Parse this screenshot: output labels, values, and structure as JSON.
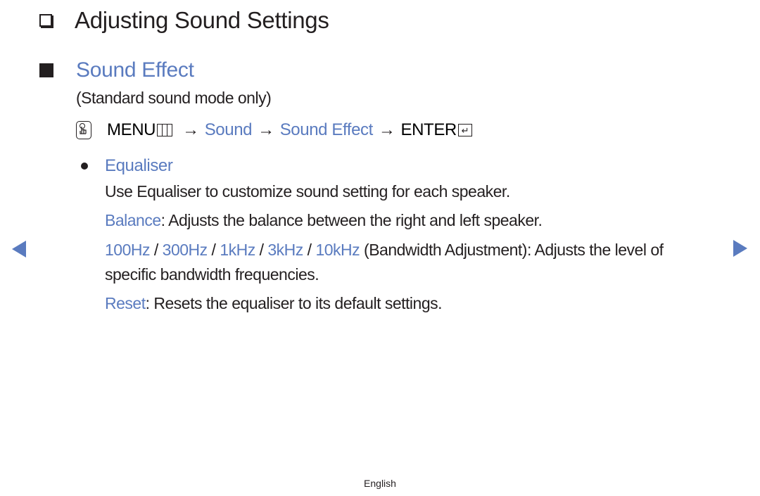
{
  "heading": {
    "icon": "hollow-square-icon",
    "title": "Adjusting Sound Settings"
  },
  "section": {
    "icon": "filled-square-icon",
    "title": "Sound Effect",
    "note": "(Standard sound mode only)"
  },
  "menu_path": {
    "icon": "hand-press-icon",
    "menu_label": "MENU",
    "menu_icon": "menu-grid-icon",
    "arrow": "→",
    "steps": [
      "Sound",
      "Sound Effect"
    ],
    "enter_label": "ENTER",
    "enter_icon": "enter-return-icon",
    "enter_glyph": "↵"
  },
  "item": {
    "bullet_icon": "bullet-dot-icon",
    "title": "Equaliser",
    "description": "Use Equaliser to customize sound setting for each speaker.",
    "balance": {
      "term": "Balance",
      "text": ": Adjusts the balance between the right and left speaker."
    },
    "bands": {
      "terms": [
        "100Hz",
        "300Hz",
        "1kHz",
        "3kHz",
        "10kHz"
      ],
      "separator": " / ",
      "text": " (Bandwidth Adjustment): Adjusts the level of specific bandwidth frequencies."
    },
    "reset": {
      "term": "Reset",
      "text": ": Resets the equaliser to its default settings."
    }
  },
  "navigation": {
    "prev_icon": "previous-page-triangle-icon",
    "next_icon": "next-page-triangle-icon"
  },
  "footer": {
    "language": "English"
  },
  "colors": {
    "accent": "#5a7bbf",
    "text": "#231f20",
    "background": "#ffffff"
  }
}
